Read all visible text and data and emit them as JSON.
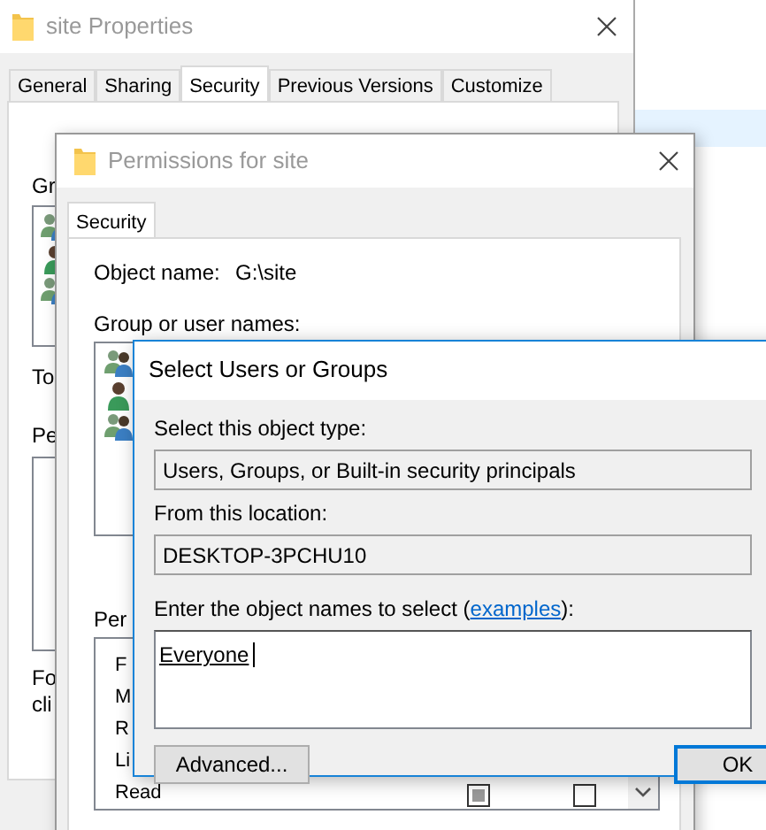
{
  "properties_window": {
    "title": "site Properties",
    "active": false,
    "tabs": [
      {
        "label": "General",
        "selected": false
      },
      {
        "label": "Sharing",
        "selected": false
      },
      {
        "label": "Security",
        "selected": true
      },
      {
        "label": "Previous Versions",
        "selected": false
      },
      {
        "label": "Customize",
        "selected": false
      }
    ],
    "group_label": "Gr",
    "to_label": "To",
    "permissions_label": "Pe",
    "footer_lines": [
      "Fo",
      "cli"
    ]
  },
  "permissions_window": {
    "title": "Permissions for site",
    "active": false,
    "tabs": [
      {
        "label": "Security",
        "selected": true
      }
    ],
    "object_name_label": "Object name:",
    "object_name": "G:\\site",
    "group_label": "Group or user names:",
    "permissions_label": "Per",
    "permission_rows": [
      {
        "label": "F"
      },
      {
        "label": "M"
      },
      {
        "label": "R"
      },
      {
        "label": "Li"
      },
      {
        "label": "Read",
        "allow": true,
        "deny": false
      }
    ]
  },
  "select_window": {
    "title": "Select Users or Groups",
    "active": true,
    "object_type_label": "Select this object type:",
    "object_type": "Users, Groups, or Built-in security principals",
    "location_label": "From this location:",
    "location": "DESKTOP-3PCHU10",
    "names_label": {
      "prefix": "Enter the object names to select (",
      "link": "examples",
      "suffix": "):"
    },
    "names_value": "Everyone",
    "buttons": [
      {
        "label": "Advanced...",
        "default": false
      },
      {
        "label": "OK",
        "default": true
      }
    ]
  }
}
